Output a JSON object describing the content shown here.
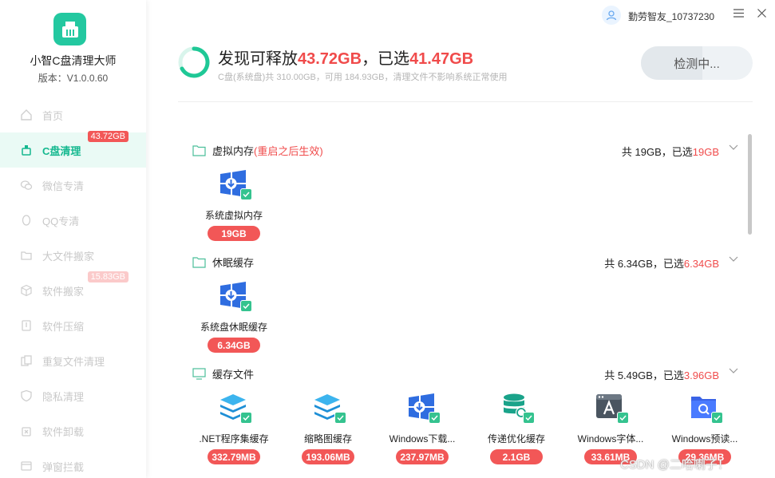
{
  "app": {
    "name": "小智C盘清理大师",
    "version": "版本：V1.0.0.60"
  },
  "nav": [
    {
      "label": "首页",
      "icon": "home-icon",
      "badge": ""
    },
    {
      "label": "C盘清理",
      "icon": "broom-icon",
      "badge": "43.72GB",
      "active": true
    },
    {
      "label": "微信专清",
      "icon": "wechat-icon",
      "badge": ""
    },
    {
      "label": "QQ专清",
      "icon": "qq-icon",
      "badge": ""
    },
    {
      "label": "大文件搬家",
      "icon": "folder-move-icon",
      "badge": ""
    },
    {
      "label": "软件搬家",
      "icon": "cube-icon",
      "badge": "15.83GB"
    },
    {
      "label": "软件压缩",
      "icon": "compress-icon",
      "badge": ""
    },
    {
      "label": "重复文件清理",
      "icon": "duplicate-icon",
      "badge": ""
    },
    {
      "label": "隐私清理",
      "icon": "shield-icon",
      "badge": ""
    },
    {
      "label": "软件卸载",
      "icon": "uninstall-icon",
      "badge": ""
    },
    {
      "label": "弹窗拦截",
      "icon": "popup-block-icon",
      "badge": ""
    }
  ],
  "topbar": {
    "user_name": "勤劳智友_10737230",
    "menu_icon": "menu-icon",
    "close_icon": "close-icon"
  },
  "header": {
    "headline_prefix": "发现可释放",
    "releasable": "43.72GB",
    "headline_mid": "，已选",
    "selected": "41.47GB",
    "subline": "C盘(系统盘)共 310.00GB，可用 184.93GB，清理文件不影响系统正常使用",
    "detect_label": "检测中...",
    "progress": 0.55
  },
  "sections": [
    {
      "title": "虚拟内存",
      "note": "(重启之后生效)",
      "summary_prefix": "共 19GB，已选",
      "summary_selected": "19GB",
      "items": [
        {
          "label": "系统虚拟内存",
          "size": "19GB",
          "icon": "windows-download-icon"
        }
      ]
    },
    {
      "title": "休眠缓存",
      "note": "",
      "summary_prefix": "共 6.34GB，已选",
      "summary_selected": "6.34GB",
      "items": [
        {
          "label": "系统盘休眠缓存",
          "size": "6.34GB",
          "icon": "windows-download-icon"
        }
      ]
    },
    {
      "title": "缓存文件",
      "note": "",
      "summary_prefix": "共 5.49GB，已选",
      "summary_selected": "3.96GB",
      "items": [
        {
          "label": ".NET程序集缓存",
          "size": "332.79MB",
          "icon": "layers-icon"
        },
        {
          "label": "缩略图缓存",
          "size": "193.06MB",
          "icon": "layers-icon"
        },
        {
          "label": "Windows下载...",
          "size": "237.97MB",
          "icon": "windows-download-icon"
        },
        {
          "label": "传递优化缓存",
          "size": "2.1GB",
          "icon": "database-icon"
        },
        {
          "label": "Windows字体...",
          "size": "33.61MB",
          "icon": "font-icon"
        },
        {
          "label": "Windows预读...",
          "size": "29.36MB",
          "icon": "search-folder-icon"
        }
      ]
    }
  ],
  "watermark": "CSDN @二哈喇子！",
  "colors": {
    "accent": "#14b88f",
    "danger": "#f04b4b",
    "check": "#35c38f"
  }
}
